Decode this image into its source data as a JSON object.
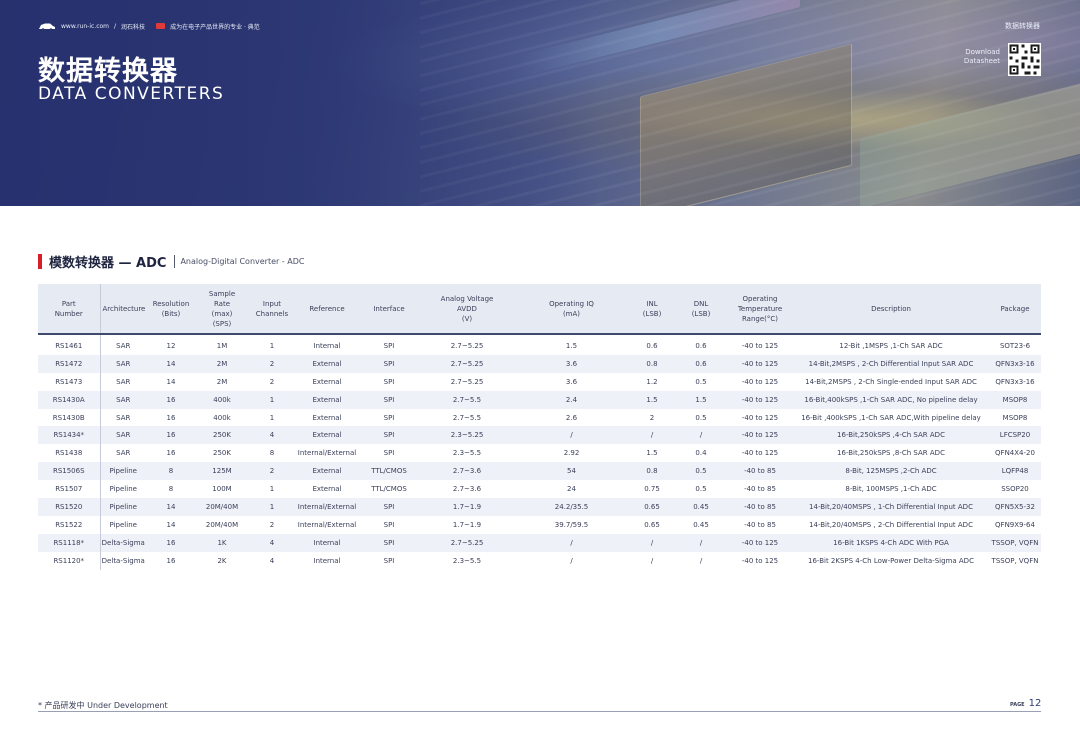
{
  "header": {
    "site": "www.run-ic.com",
    "company": "润石科技",
    "slogan": "成为在电子产品世界的专业 · 典范",
    "category": "数据转换器",
    "title_cn": "数据转换器",
    "title_en": "DATA CONVERTERS",
    "download_line1": "Download",
    "download_line2": "Datasheet"
  },
  "section": {
    "title_cn": "模数转换器 — ADC",
    "title_en": "Analog-Digital Converter - ADC"
  },
  "table": {
    "headers": [
      [
        "Part",
        "Number"
      ],
      [
        "Architecture"
      ],
      [
        "Resolution",
        "(Bits)"
      ],
      [
        "Sample",
        "Rate",
        "(max)",
        "(SPS)"
      ],
      [
        "Input",
        "Channels"
      ],
      [
        "Reference"
      ],
      [
        "Interface"
      ],
      [
        "Analog Voltage",
        "AVDD",
        "(V)"
      ],
      [
        "Operating IQ",
        "(mA)"
      ],
      [
        "INL",
        "(LSB)"
      ],
      [
        "DNL",
        "(LSB)"
      ],
      [
        "Operating",
        "Temperature",
        "Range(°C)"
      ],
      [
        "Description"
      ],
      [
        "Package"
      ]
    ],
    "rows": [
      [
        "RS1461",
        "SAR",
        "12",
        "1M",
        "1",
        "Internal",
        "SPI",
        "2.7~5.25",
        "1.5",
        "0.6",
        "0.6",
        "-40 to 125",
        "12-Bit ,1MSPS ,1-Ch SAR ADC",
        "SOT23-6"
      ],
      [
        "RS1472",
        "SAR",
        "14",
        "2M",
        "2",
        "External",
        "SPI",
        "2.7~5.25",
        "3.6",
        "0.8",
        "0.6",
        "-40 to 125",
        "14-Bit,2MSPS , 2-Ch Differential Input SAR ADC",
        "QFN3x3-16"
      ],
      [
        "RS1473",
        "SAR",
        "14",
        "2M",
        "2",
        "External",
        "SPI",
        "2.7~5.25",
        "3.6",
        "1.2",
        "0.5",
        "-40 to 125",
        "14-Bit,2MSPS , 2-Ch Single-ended Input SAR ADC",
        "QFN3x3-16"
      ],
      [
        "RS1430A",
        "SAR",
        "16",
        "400k",
        "1",
        "External",
        "SPI",
        "2.7~5.5",
        "2.4",
        "1.5",
        "1.5",
        "-40 to 125",
        "16-Bit,400kSPS ,1-Ch SAR ADC, No pipeline delay",
        "MSOP8"
      ],
      [
        "RS1430B",
        "SAR",
        "16",
        "400k",
        "1",
        "External",
        "SPI",
        "2.7~5.5",
        "2.6",
        "2",
        "0.5",
        "-40 to 125",
        "16-Bit ,400kSPS ,1-Ch SAR ADC,With pipeline delay",
        "MSOP8"
      ],
      [
        "RS1434*",
        "SAR",
        "16",
        "250K",
        "4",
        "External",
        "SPI",
        "2.3~5.25",
        "/",
        "/",
        "/",
        "-40 to 125",
        "16-Bit,250kSPS ,4-Ch SAR ADC",
        "LFCSP20"
      ],
      [
        "RS1438",
        "SAR",
        "16",
        "250K",
        "8",
        "Internal/External",
        "SPI",
        "2.3~5.5",
        "2.92",
        "1.5",
        "0.4",
        "-40 to 125",
        "16-Bit,250kSPS ,8-Ch SAR ADC",
        "QFN4X4-20"
      ],
      [
        "RS1506S",
        "Pipeline",
        "8",
        "125M",
        "2",
        "External",
        "TTL/CMOS",
        "2.7~3.6",
        "54",
        "0.8",
        "0.5",
        "-40 to 85",
        "8-Bit, 125MSPS ,2-Ch ADC",
        "LQFP48"
      ],
      [
        "RS1507",
        "Pipeline",
        "8",
        "100M",
        "1",
        "External",
        "TTL/CMOS",
        "2.7~3.6",
        "24",
        "0.75",
        "0.5",
        "-40 to 85",
        "8-Bit, 100MSPS ,1-Ch ADC",
        "SSOP20"
      ],
      [
        "RS1520",
        "Pipeline",
        "14",
        "20M/40M",
        "1",
        "Internal/External",
        "SPI",
        "1.7~1.9",
        "24.2/35.5",
        "0.65",
        "0.45",
        "-40 to 85",
        "14-Bit,20/40MSPS , 1-Ch Differential Input ADC",
        "QFN5X5-32"
      ],
      [
        "RS1522",
        "Pipeline",
        "14",
        "20M/40M",
        "2",
        "Internal/External",
        "SPI",
        "1.7~1.9",
        "39.7/59.5",
        "0.65",
        "0.45",
        "-40 to 85",
        "14-Bit,20/40MSPS , 2-Ch Differential Input ADC",
        "QFN9X9-64"
      ],
      [
        "RS1118*",
        "Delta-Sigma",
        "16",
        "1K",
        "4",
        "Internal",
        "SPI",
        "2.7~5.25",
        "/",
        "/",
        "/",
        "-40 to 125",
        "16-Bit 1KSPS 4-Ch ADC With PGA",
        "TSSOP, VQFN"
      ],
      [
        "RS1120*",
        "Delta-Sigma",
        "16",
        "2K",
        "4",
        "Internal",
        "SPI",
        "2.3~5.5",
        "/",
        "/",
        "/",
        "-40 to 125",
        "16-Bit 2KSPS 4-Ch Low-Power Delta-Sigma ADC",
        "TSSOP, VQFN"
      ]
    ]
  },
  "footer": {
    "note": "* 产品研发中  Under Development",
    "page_label": "PAGE",
    "page_number": "12"
  },
  "colors": {
    "accent_red": "#d71e28",
    "header_bg": "#e6eaf3",
    "row_alt": "#eef1f8"
  },
  "icons": [
    "car-logo-icon",
    "qr-code-icon"
  ]
}
